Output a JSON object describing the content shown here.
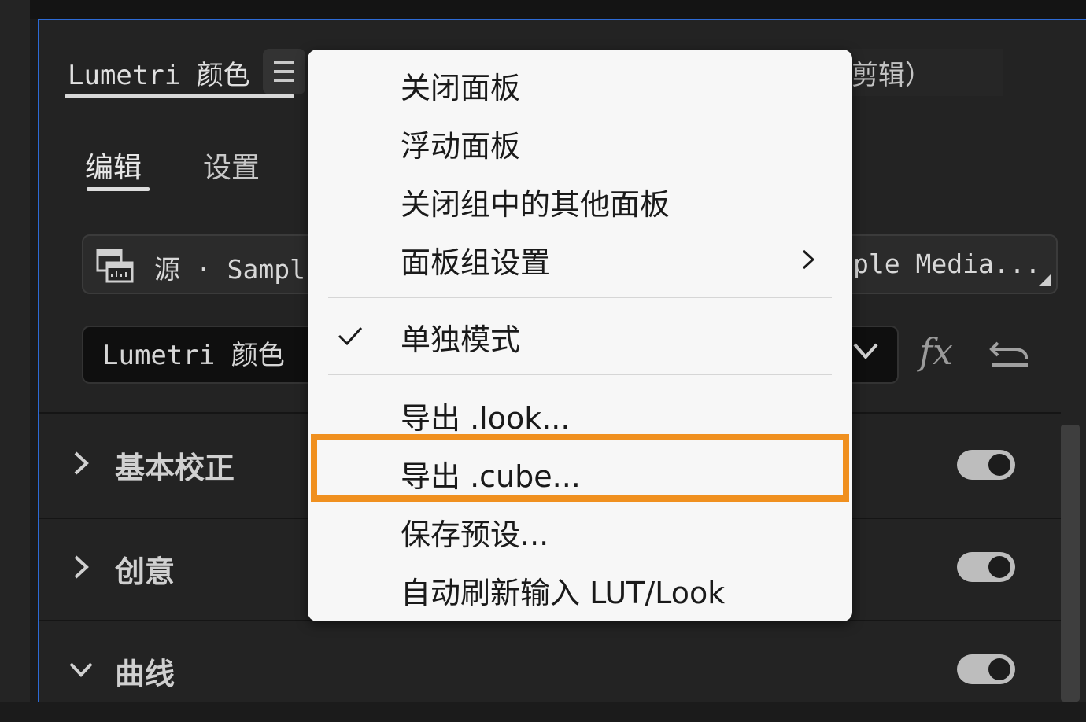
{
  "panel": {
    "tab_title": "Lumetri 颜色",
    "right_tab_partial": "剪辑）",
    "subtabs": {
      "edit": "编辑",
      "settings": "设置"
    },
    "source": {
      "left_label": "源 · Sampl",
      "right_label": "ple Media..."
    },
    "effect_select": {
      "value": "Lumetri 颜色"
    },
    "fx_label": "fx",
    "sections": [
      {
        "label": "基本校正",
        "expanded": false,
        "enabled": true
      },
      {
        "label": "创意",
        "expanded": false,
        "enabled": true
      },
      {
        "label": "曲线",
        "expanded": true,
        "enabled": true
      }
    ]
  },
  "context_menu": {
    "items": [
      {
        "label": "关闭面板"
      },
      {
        "label": "浮动面板"
      },
      {
        "label": "关闭组中的其他面板"
      },
      {
        "label": "面板组设置",
        "has_submenu": true
      },
      {
        "label": "单独模式",
        "checked": true
      },
      {
        "label": "导出 .look..."
      },
      {
        "label": "导出 .cube...",
        "highlighted": true
      },
      {
        "label": "保存预设..."
      },
      {
        "label": "自动刷新输入 LUT/Look"
      }
    ]
  },
  "colors": {
    "highlight": "#f0901f",
    "panel_border": "#2d6bd6",
    "menu_bg": "#f7f7f7",
    "panel_bg": "#232323"
  },
  "icons": [
    "menu-icon",
    "clip-icon",
    "chevron-down-icon",
    "fx-icon",
    "reset-icon",
    "chevron-right-icon",
    "checkmark-icon",
    "submenu-arrow-icon"
  ]
}
